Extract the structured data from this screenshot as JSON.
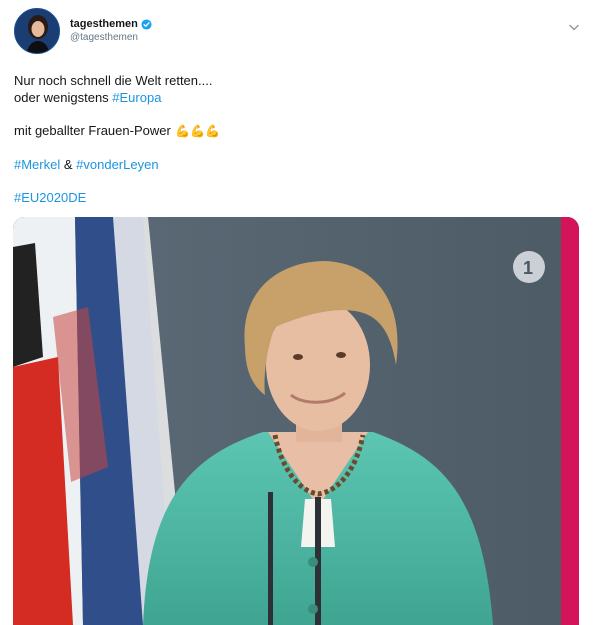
{
  "account": {
    "display_name": "tagesthemen",
    "handle": "@tagesthemen",
    "verified": true
  },
  "icons": {
    "verified": "verified-badge-icon",
    "menu": "chevron-down-icon",
    "emoji": "flexed-biceps-emoji",
    "channel_logo": "ard-das-erste-logo"
  },
  "tweet": {
    "line1": "Nur noch schnell die Welt retten....",
    "line2_prefix": "oder wenigstens ",
    "line2_hashtag": "#Europa",
    "line3_text": "mit geballter Frauen-Power ",
    "line3_emojis": "💪💪💪",
    "hashtag_merkel": "#Merkel",
    "ampersand": " & ",
    "hashtag_vdl": "#vonderLeyen",
    "hashtag_eu": "#EU2020DE"
  },
  "colors": {
    "link": "#1b95e0",
    "text": "#14171a",
    "secondary": "#657786",
    "verified": "#1da1f2",
    "backdrop": "#53616d",
    "jacket": "#4fb7a4",
    "accent_stripe": "#d4145a"
  }
}
